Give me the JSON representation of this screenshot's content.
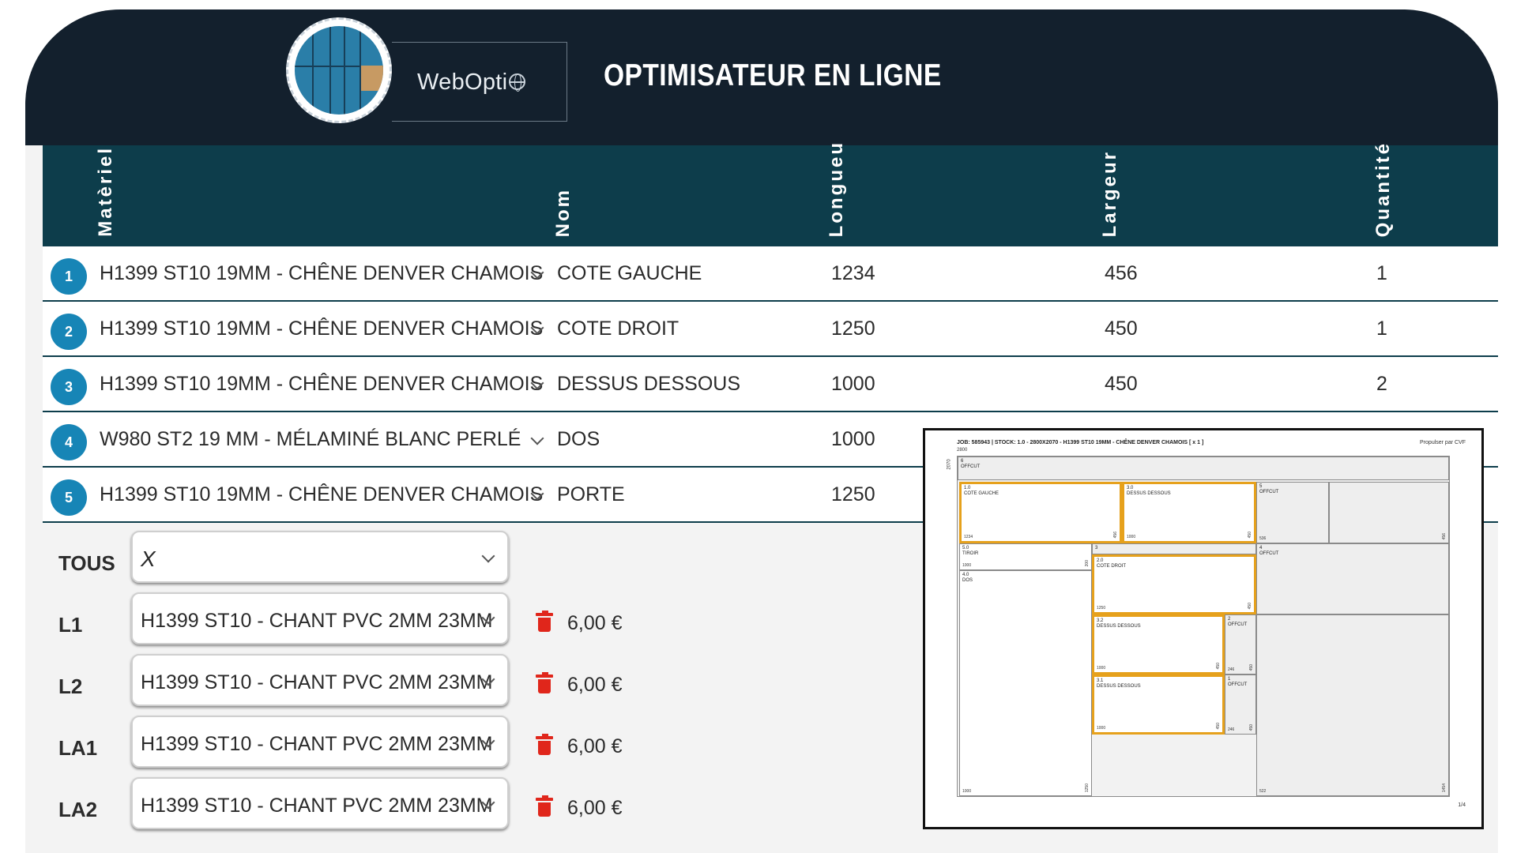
{
  "header": {
    "logo_text": "WebOpti",
    "title": "OPTIMISATEUR EN LIGNE"
  },
  "table": {
    "columns": {
      "materiel": "Matèriel",
      "nom": "Nom",
      "longueur": "Longueu",
      "largeur": "Largeur",
      "quantite": "Quantité"
    },
    "rows": [
      {
        "num": "1",
        "material": "H1399 ST10 19MM - CHÊNE DENVER CHAMOIS",
        "name": "COTE GAUCHE",
        "length": "1234",
        "width": "456",
        "qty": "1"
      },
      {
        "num": "2",
        "material": "H1399 ST10 19MM - CHÊNE DENVER CHAMOIS",
        "name": "COTE DROIT",
        "length": "1250",
        "width": "450",
        "qty": "1"
      },
      {
        "num": "3",
        "material": "H1399 ST10 19MM - CHÊNE DENVER CHAMOIS",
        "name": "DESSUS DESSOUS",
        "length": "1000",
        "width": "450",
        "qty": "2"
      },
      {
        "num": "4",
        "material": "W980 ST2 19 MM - MÉLAMINÉ BLANC PERLÉ",
        "name": "DOS",
        "length": "1000",
        "width": "",
        "qty": ""
      },
      {
        "num": "5",
        "material": "H1399 ST10 19MM - CHÊNE DENVER CHAMOIS",
        "name": "PORTE",
        "length": "1250",
        "width": "",
        "qty": ""
      }
    ]
  },
  "edges": {
    "all": {
      "label": "TOUS",
      "value": "X"
    },
    "items": [
      {
        "label": "L1",
        "value": "H1399 ST10 - CHANT PVC 2MM 23MM",
        "price": "6,00 €"
      },
      {
        "label": "L2",
        "value": "H1399 ST10 - CHANT PVC 2MM 23MM",
        "price": "6,00 €"
      },
      {
        "label": "LA1",
        "value": "H1399 ST10 - CHANT PVC 2MM 23MM",
        "price": "6,00 €"
      },
      {
        "label": "LA2",
        "value": "H1399 ST10 - CHANT PVC 2MM 23MM",
        "price": "6,00 €"
      }
    ]
  },
  "preview": {
    "job": "JOB: 585943 | STOCK: 1.0 - 2800X2070 - H1399 ST10 19MM - CHÊNE DENVER CHAMOIS [ x 1 ]",
    "by": "Propulser par CVF",
    "sheet_w": "2800",
    "sheet_h": "2070",
    "page": "1/4",
    "pieces": {
      "top_offcut": {
        "id": "6",
        "name": "OFFCUT"
      },
      "cote_gauche": {
        "id": "1.0",
        "name": "COTE GAUCHE",
        "w": "1234",
        "h": "456"
      },
      "dessus_1": {
        "id": "3.0",
        "name": "DESSUS DESSOUS",
        "w": "1000",
        "h": "450"
      },
      "offcut_5": {
        "id": "5",
        "name": "OFFCUT",
        "w": "536",
        "h": "456"
      },
      "tiroir": {
        "id": "5.0",
        "name": "TIROIR",
        "w": "1000",
        "h": "200"
      },
      "strip_3": {
        "id": "3"
      },
      "offcut_4": {
        "id": "4",
        "name": "OFFCUT"
      },
      "cote_droit": {
        "id": "2.0",
        "name": "COTE DROIT",
        "w": "1250",
        "h": "450"
      },
      "dos": {
        "id": "4.0",
        "name": "DOS",
        "w": "1000",
        "h": "1250"
      },
      "dessus_2": {
        "id": "3.2",
        "name": "DESSUS DESSOUS",
        "w": "1000",
        "h": "450"
      },
      "offcut_2": {
        "id": "2",
        "name": "OFFCUT",
        "w": "246",
        "h": "450"
      },
      "dessus_3": {
        "id": "3.1",
        "name": "DESSUS DESSOUS",
        "w": "1000",
        "h": "450"
      },
      "offcut_1": {
        "id": "1",
        "name": "OFFCUT",
        "w": "246",
        "h": "450"
      },
      "right_strip": {
        "w": "522",
        "h": "1454"
      }
    }
  }
}
